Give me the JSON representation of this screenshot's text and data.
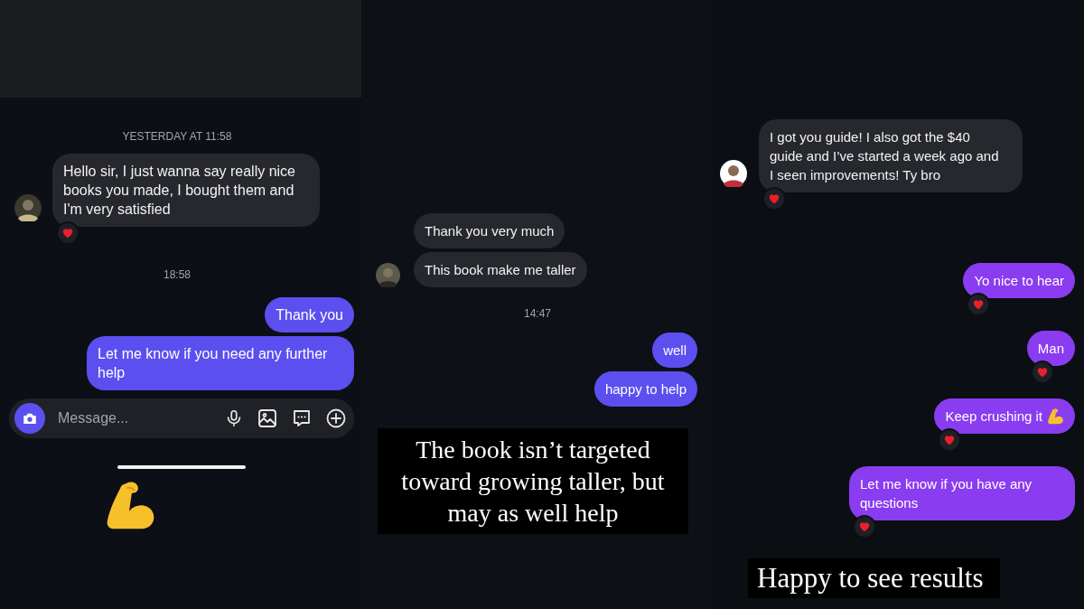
{
  "panels": [
    {
      "color": "#5b4ff0",
      "items": [
        {
          "kind": "header"
        },
        {
          "kind": "timestamp",
          "text": "YESTERDAY AT 11:58"
        },
        {
          "kind": "received",
          "avatar": true,
          "messages": [
            {
              "text": "Hello sir, I just wanna say really nice books you made, I bought them and I'm very satisfied",
              "reaction": true
            }
          ]
        },
        {
          "kind": "timestamp",
          "text": "18:58"
        },
        {
          "kind": "sent",
          "messages": [
            {
              "text": "Thank you",
              "reaction": false
            },
            {
              "text": "Let me know if you need any further help",
              "reaction": false
            }
          ]
        },
        {
          "kind": "composer",
          "placeholder": "Message..."
        },
        {
          "kind": "home-bar"
        },
        {
          "kind": "emoji"
        }
      ]
    },
    {
      "color": "#5b4ff0",
      "items": [
        {
          "kind": "received",
          "avatar": true,
          "messages": [
            {
              "text": "Thank you very much",
              "reaction": false
            },
            {
              "text": "This book make me taller",
              "reaction": false
            }
          ]
        },
        {
          "kind": "timestamp",
          "text": "14:47"
        },
        {
          "kind": "sent",
          "messages": [
            {
              "text": "well",
              "reaction": false
            },
            {
              "text": "happy to help",
              "reaction": false
            }
          ]
        },
        {
          "kind": "caption",
          "text": "The book isn’t targeted toward growing taller, but may as well help"
        }
      ]
    },
    {
      "color": "#8a3cf0",
      "items": [
        {
          "kind": "received",
          "avatar": true,
          "messages": [
            {
              "text": "I got you guide! I also got the $40 guide and I’ve started a week ago and I seen improvements! Ty bro",
              "reaction": true
            }
          ]
        },
        {
          "kind": "sent",
          "messages": [
            {
              "text": "Yo nice to hear",
              "reaction": true
            }
          ]
        },
        {
          "kind": "sent",
          "messages": [
            {
              "text": "Man",
              "reaction": true
            }
          ]
        },
        {
          "kind": "sent",
          "messages": [
            {
              "text": "Keep crushing it",
              "reaction": true,
              "trailing_emoji": true
            }
          ]
        },
        {
          "kind": "sent",
          "messages": [
            {
              "text": "Let me know if you have any questions",
              "reaction": true
            }
          ]
        },
        {
          "kind": "caption",
          "text": "Happy to see results"
        }
      ]
    }
  ]
}
